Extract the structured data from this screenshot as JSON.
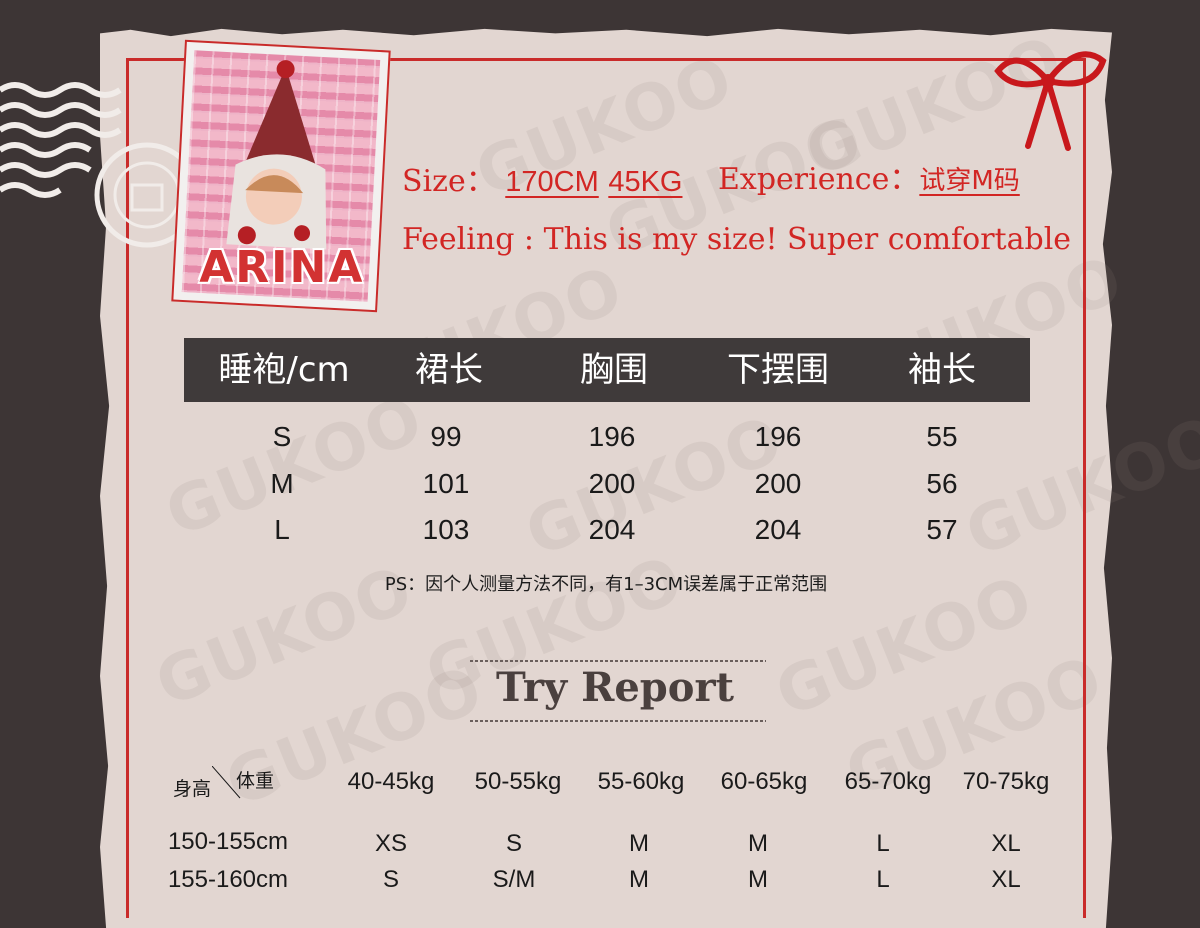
{
  "profile": {
    "photo_name": "ARINA",
    "size_label": "Size：",
    "height": "170CM",
    "weight": "45KG",
    "experience_label": "Experience：",
    "experience_value": "试穿M码",
    "feeling": "Feeling : This is my size! Super comfortable"
  },
  "size_table": {
    "headers": [
      "睡袍/cm",
      "裙长",
      "胸围",
      "下摆围",
      "袖长"
    ],
    "rows": [
      [
        "S",
        "99",
        "196",
        "196",
        "55"
      ],
      [
        "M",
        "101",
        "200",
        "200",
        "56"
      ],
      [
        "L",
        "103",
        "204",
        "204",
        "57"
      ]
    ],
    "note": "PS：因个人测量方法不同，有1–3CM误差属于正常范围"
  },
  "try_report": {
    "title": "Try Report",
    "corner_height": "身高",
    "corner_weight": "体重",
    "weight_ranges": [
      "40-45kg",
      "50-55kg",
      "55-60kg",
      "60-65kg",
      "65-70kg",
      "70-75kg"
    ],
    "rows": [
      {
        "height": "150-155cm",
        "sizes": [
          "XS",
          "S",
          "M",
          "M",
          "L",
          "XL"
        ]
      },
      {
        "height": "155-160cm",
        "sizes": [
          "S",
          "S/M",
          "M",
          "M",
          "L",
          "XL"
        ]
      }
    ]
  },
  "watermark_text": "GUKOO",
  "colors": {
    "accent_red": "#c92b2a",
    "header_bg": "#3f3a3a",
    "paper": "#e2d6d1",
    "background": "#3d3535"
  }
}
